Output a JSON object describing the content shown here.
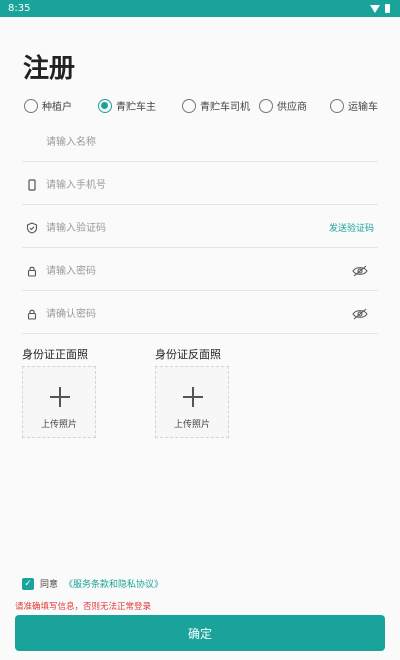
{
  "status_bar": {
    "time": "8:35"
  },
  "page_title": "注册",
  "roles": {
    "options": [
      "种植户",
      "青贮车主",
      "青贮车司机",
      "供应商",
      "运输车"
    ],
    "selected": "青贮车主"
  },
  "form": {
    "name_placeholder": "请输入名称",
    "phone_placeholder": "请输入手机号",
    "code_placeholder": "请输入验证码",
    "send_code_label": "发送验证码",
    "password_placeholder": "请输入密码",
    "confirm_password_placeholder": "请确认密码"
  },
  "id_card": {
    "front_label": "身份证正面照",
    "back_label": "身份证反面照",
    "upload_label": "上传照片"
  },
  "agreement": {
    "checked": true,
    "agree_label": "同意",
    "policy_link": "《服务条款和隐私协议》"
  },
  "warning": "请准确填写信息，否则无法正常登录",
  "confirm_button": "确定",
  "colors": {
    "accent": "#1aa39a",
    "warning": "#e23b3b"
  },
  "icons": [
    "wifi-icon",
    "battery-icon",
    "phone-icon",
    "shield-icon",
    "lock-icon",
    "eye-icon",
    "plus-icon",
    "check-icon"
  ]
}
